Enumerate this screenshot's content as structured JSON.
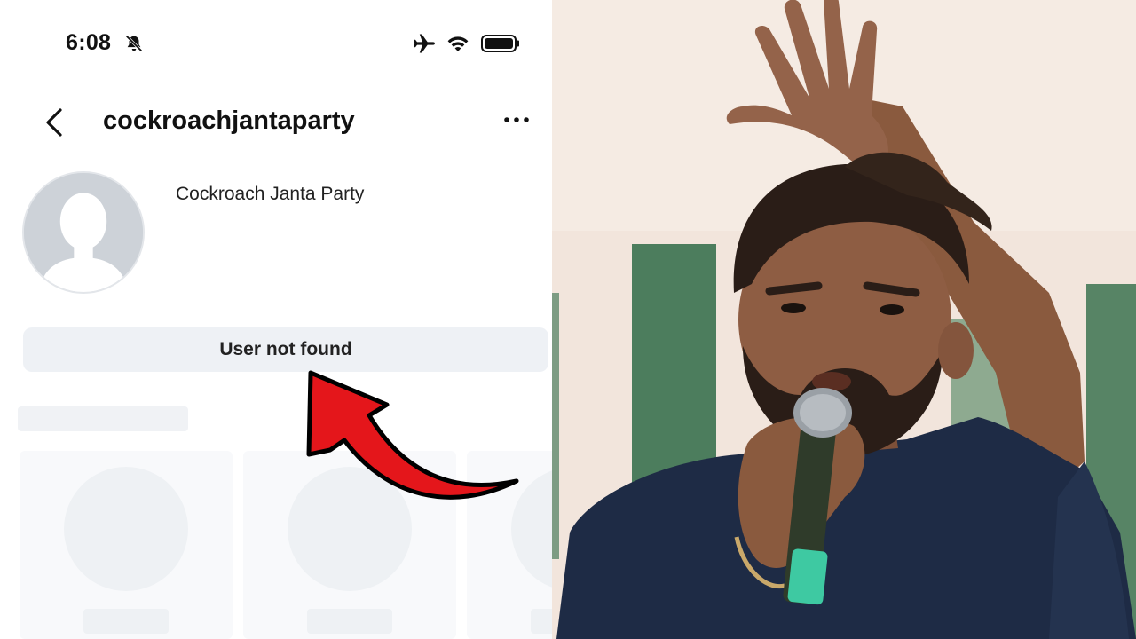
{
  "status_bar": {
    "time": "6:08",
    "icons": [
      "bell-slash-icon",
      "airplane-icon",
      "wifi-icon",
      "battery-icon"
    ]
  },
  "nav": {
    "back_icon": "chevron-left-icon",
    "username": "cockroachjantaparty",
    "more_icon": "more-horizontal-icon"
  },
  "profile": {
    "avatar_icon": "default-avatar-icon",
    "display_name": "Cockroach Janta Party"
  },
  "banner": {
    "message": "User not found"
  },
  "annotation": {
    "arrow_color": "#e4161b",
    "arrow_icon": "curved-arrow-icon"
  },
  "photo": {
    "description_icon": "man-speaking-with-microphone-photo"
  },
  "colors": {
    "page_bg": "#ffffff",
    "banner_bg": "#eef1f5",
    "skeleton": "#f0f2f5",
    "shirt": "#1e2b45",
    "wall": "#f2e5dc",
    "green_panel": "#2d6a45"
  }
}
